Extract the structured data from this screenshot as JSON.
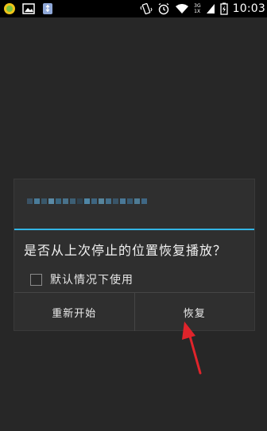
{
  "status_bar": {
    "time": "10:03",
    "network_top": "3G",
    "network_bottom": "1X",
    "icons_left": [
      "app-icon",
      "image-icon",
      "usb-icon"
    ],
    "icons_right": [
      "vibrate-icon",
      "alarm-icon",
      "wifi-icon",
      "signal-icon",
      "battery-icon"
    ]
  },
  "dialog": {
    "message": "是否从上次停止的位置恢复播放？",
    "checkbox_label": "默认情况下使用",
    "checkbox_checked": false,
    "buttons": {
      "restart": "重新开始",
      "resume": "恢复"
    }
  },
  "colors": {
    "accent_divider": "#33b5e5",
    "annotation_arrow": "#e0242b",
    "background": "#272727"
  }
}
